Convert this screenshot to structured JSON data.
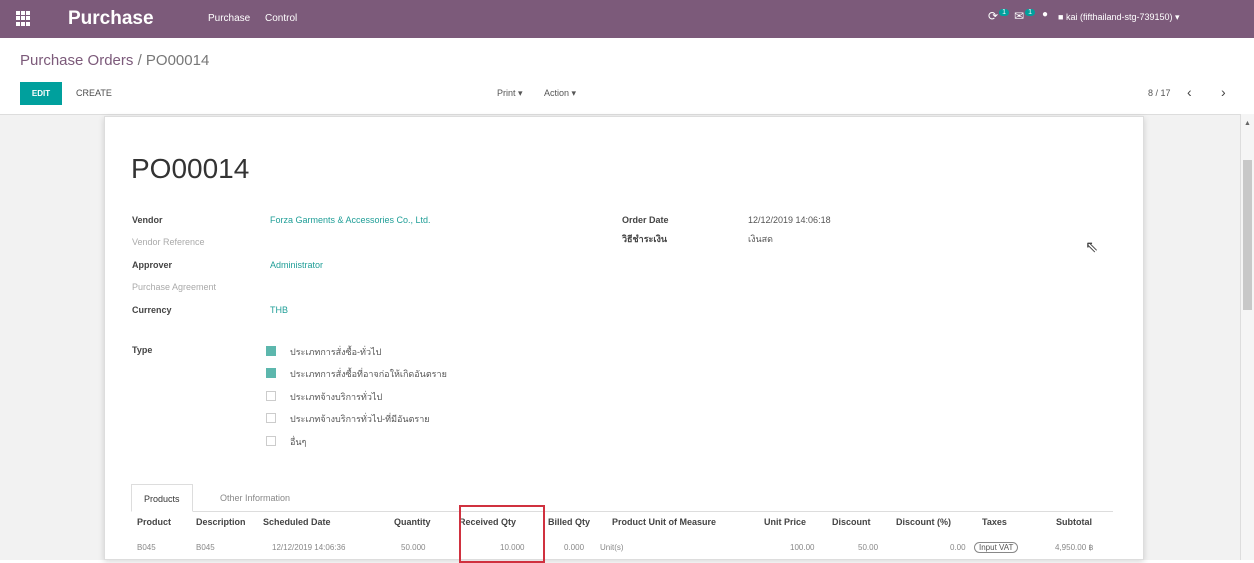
{
  "header": {
    "app_title": "Purchase",
    "menu": [
      "Purchase",
      "Control"
    ],
    "activity_count": "1",
    "message_count": "1",
    "user": "kai (fifthailand-stg-739150)"
  },
  "breadcrumb": {
    "parent": "Purchase Orders",
    "separator": "/",
    "current": "PO00014"
  },
  "controls": {
    "edit_label": "EDIT",
    "create_label": "CREATE",
    "print_label": "Print",
    "action_label": "Action",
    "pager": "8 / 17",
    "prev_glyph": "‹",
    "next_glyph": "›"
  },
  "form": {
    "title": "PO00014",
    "vendor_label": "Vendor",
    "vendor_value": "Forza Garments & Accessories Co., Ltd.",
    "vendor_ref_label": "Vendor Reference",
    "approver_label": "Approver",
    "approver_value": "Administrator",
    "agreement_label": "Purchase Agreement",
    "currency_label": "Currency",
    "currency_value": "THB",
    "order_date_label": "Order Date",
    "order_date_value": "12/12/2019 14:06:18",
    "payment_label": "วิธีชำระเงิน",
    "payment_value": "เงินสด",
    "type_label": "Type",
    "types": [
      {
        "label": "ประเภทการสั่งซื้อ-ทั่วไป",
        "checked": true
      },
      {
        "label": "ประเภทการสั่งซื้อที่อาจก่อให้เกิดอันตราย",
        "checked": true
      },
      {
        "label": "ประเภทจ้างบริการทั่วไป",
        "checked": false
      },
      {
        "label": "ประเภทจ้างบริการทั่วไป-ที่มีอันตราย",
        "checked": false
      },
      {
        "label": "อื่นๆ",
        "checked": false
      }
    ]
  },
  "tabs": {
    "products": "Products",
    "other": "Other Information"
  },
  "lines": {
    "headers": [
      "Product",
      "Description",
      "Scheduled Date",
      "Quantity",
      "Received Qty",
      "Billed Qty",
      "Product Unit of Measure",
      "Unit Price",
      "Discount",
      "Discount (%)",
      "Taxes",
      "Subtotal"
    ],
    "rows": [
      {
        "product": "B045",
        "description": "B045",
        "scheduled": "12/12/2019 14:06:36",
        "quantity": "50.000",
        "received": "10.000",
        "billed": "0.000",
        "uom": "Unit(s)",
        "unit_price": "100.00",
        "discount": "50.00",
        "discount_pct": "0.00",
        "taxes": "Input VAT",
        "subtotal": "4,950.00 ฿"
      }
    ]
  },
  "colors": {
    "topbar": "#7c5a7a",
    "accent": "#00a09d",
    "highlight": "#d0313f"
  }
}
